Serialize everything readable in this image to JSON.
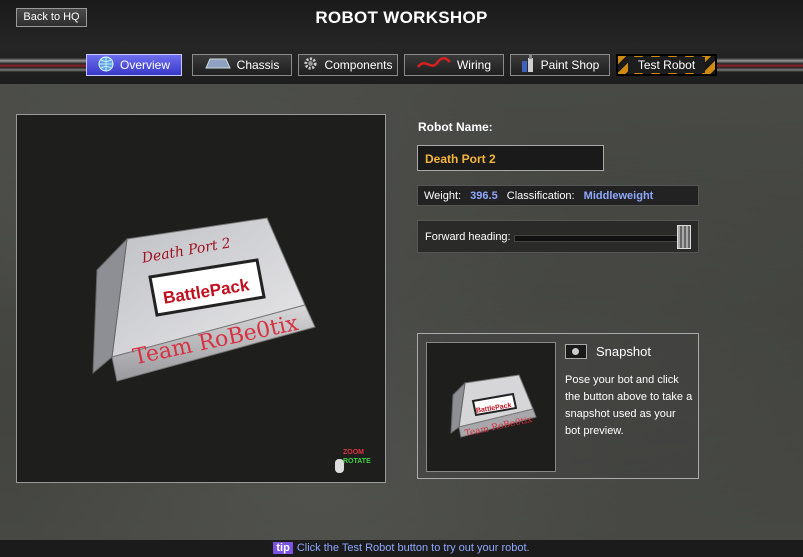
{
  "header": {
    "back_label": "Back to HQ",
    "title": "ROBOT WORKSHOP"
  },
  "tabs": [
    {
      "label": "Overview",
      "icon": "globe-icon",
      "active": true
    },
    {
      "label": "Chassis",
      "icon": "chassis-icon"
    },
    {
      "label": "Components",
      "icon": "gear-icon"
    },
    {
      "label": "Wiring",
      "icon": "wire-icon"
    },
    {
      "label": "Paint Shop",
      "icon": "paint-icon"
    },
    {
      "label": "Test Robot",
      "icon": "hazard-stripe"
    }
  ],
  "viewport": {
    "zoom_hint": "ZOOM",
    "rotate_hint": "ROTATE",
    "robot_decals": {
      "top": "Death Port 2",
      "badge": "BattlePack",
      "front": "Team RoBe0tix"
    }
  },
  "robot": {
    "name_label": "Robot Name:",
    "name_value": "Death Port 2",
    "weight_label": "Weight:",
    "weight_value": "396.5",
    "class_label": "Classification:",
    "class_value": "Middleweight",
    "heading_label": "Forward heading:",
    "heading_level": 0.95
  },
  "snapshot": {
    "label": "Snapshot",
    "description": "Pose your bot and click the button above to take a snapshot used as your bot preview."
  },
  "tip": {
    "badge": "tip",
    "text": "Click the Test Robot button to try out your robot."
  },
  "colors": {
    "accent": "#4a4ae0",
    "name": "#f4b63a",
    "value": "#8fa8ff"
  }
}
